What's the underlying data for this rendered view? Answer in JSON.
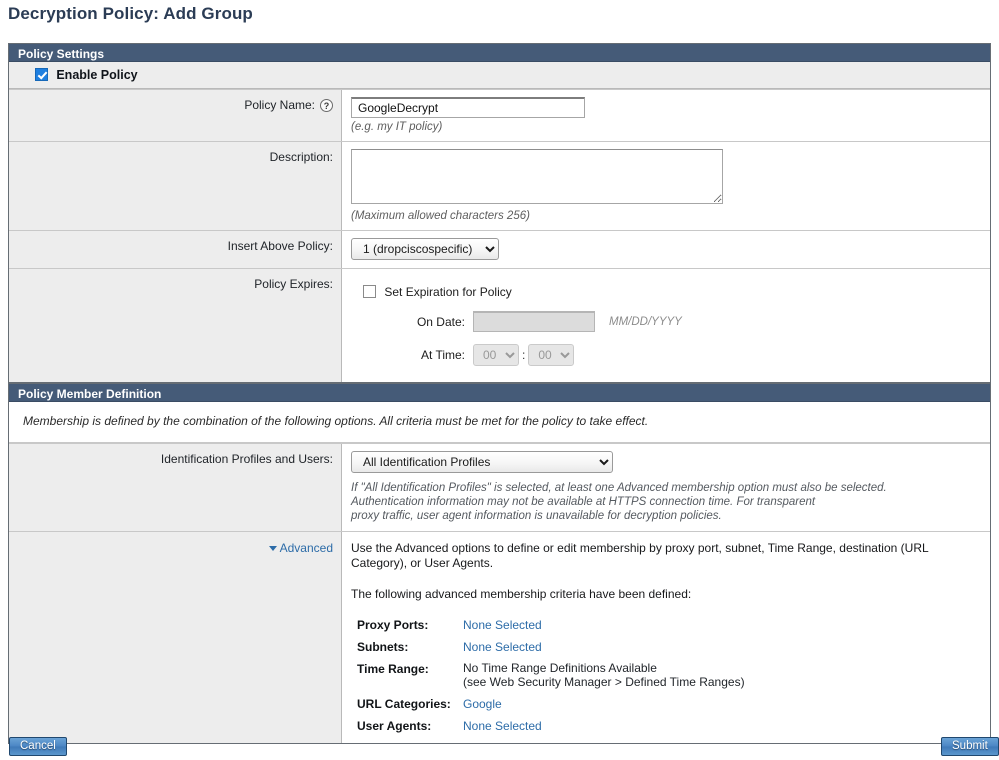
{
  "page": {
    "title": "Decryption Policy: Add Group"
  },
  "policy_settings": {
    "header": "Policy Settings",
    "enable_policy": {
      "label": "Enable Policy",
      "checked": true
    },
    "policy_name": {
      "label": "Policy Name:",
      "help_icon": "question-mark-icon",
      "value": "GoogleDecrypt",
      "hint": "(e.g. my IT policy)"
    },
    "description": {
      "label": "Description:",
      "value": "",
      "hint": "(Maximum allowed characters 256)"
    },
    "insert_above_policy": {
      "label": "Insert Above Policy:",
      "selected": "1 (dropciscospecific)",
      "options": [
        "1 (dropciscospecific)"
      ]
    },
    "policy_expires": {
      "label": "Policy Expires:",
      "set_expiration": {
        "label": "Set Expiration for Policy",
        "checked": false
      },
      "on_date": {
        "label": "On Date:",
        "value": "",
        "format_hint": "MM/DD/YYYY",
        "disabled": true
      },
      "at_time": {
        "label": "At Time:",
        "hours": "00",
        "minutes": "00",
        "separator": ":",
        "disabled": true
      }
    }
  },
  "policy_member_definition": {
    "header": "Policy Member Definition",
    "intro": "Membership is defined by the combination of the following options. All criteria must be met for the policy to take effect.",
    "identification": {
      "label": "Identification Profiles and Users:",
      "selected": "All Identification Profiles",
      "options": [
        "All Identification Profiles"
      ],
      "note_line1": "If \"All Identification Profiles\" is selected, at least one Advanced membership option must also be selected.",
      "note_line2": "Authentication information may not be available at HTTPS connection time. For transparent",
      "note_line3": "proxy traffic, user agent information is unavailable for decryption policies."
    },
    "advanced": {
      "link_label": "Advanced",
      "toggle_icon": "chevron-down-icon",
      "paragraph1": "Use the Advanced options to define or edit membership by proxy port, subnet, Time Range, destination (URL Category), or User Agents.",
      "paragraph2": "The following advanced membership criteria have been defined:",
      "criteria": [
        {
          "key": "Proxy Ports:",
          "value": "None Selected",
          "is_link": true
        },
        {
          "key": "Subnets:",
          "value": "None Selected",
          "is_link": true
        },
        {
          "key": "Time Range:",
          "value": "No Time Range Definitions Available",
          "value2": "(see Web Security Manager > Defined Time Ranges)",
          "is_link": false
        },
        {
          "key": "URL Categories:",
          "value": "Google",
          "is_link": true
        },
        {
          "key": "User Agents:",
          "value": "None Selected",
          "is_link": true
        }
      ]
    }
  },
  "footer": {
    "cancel_label": "Cancel",
    "submit_label": "Submit"
  },
  "colors": {
    "panel_header": "#455B78",
    "title": "#2B3C55",
    "link": "#2D6CA8",
    "label_bg": "#EDEDED",
    "checkbox_checked": "#1F7FE0",
    "button_blue": "#4B86C4"
  }
}
